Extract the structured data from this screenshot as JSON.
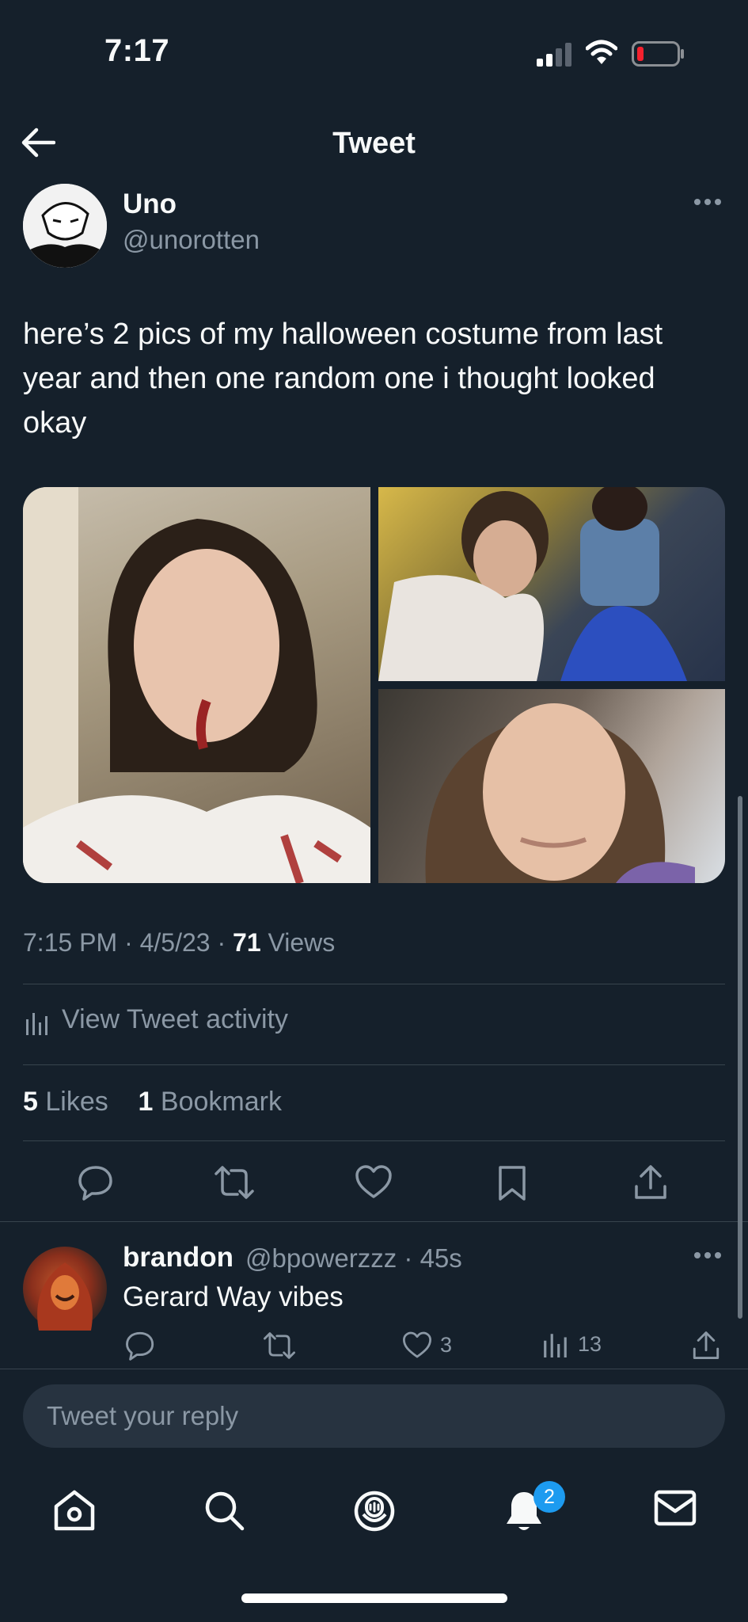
{
  "status_bar": {
    "time": "7:17",
    "signal_icon": "signal-icon",
    "wifi_icon": "wifi-icon",
    "battery_icon": "battery-low-icon",
    "battery_color": "#f4212e"
  },
  "header": {
    "title": "Tweet",
    "back_icon": "arrow-left-icon"
  },
  "tweet": {
    "author_name": "Uno",
    "author_handle": "@unorotten",
    "text": "here’s 2 pics of my halloween costume from last year and then one random one i thought looked okay",
    "photos": 3,
    "time": "7:15 PM",
    "date": "4/5/23",
    "views_count": "71",
    "views_label": "Views",
    "activity_label": "View Tweet activity",
    "likes_count": "5",
    "likes_label": "Likes",
    "bookmarks_count": "1",
    "bookmarks_label": "Bookmark",
    "action_icons": [
      "reply-icon",
      "retweet-icon",
      "like-icon",
      "bookmark-icon",
      "share-icon"
    ]
  },
  "reply": {
    "author_name": "brandon",
    "author_handle": "@bpowerzzz",
    "time": "45s",
    "text": "Gerard Way vibes",
    "likes": "3",
    "views": "13"
  },
  "reply_input": {
    "placeholder": "Tweet your reply"
  },
  "tab_bar": {
    "items": [
      "home-icon",
      "search-icon",
      "spaces-icon",
      "notifications-icon",
      "messages-icon"
    ],
    "notification_count": "2"
  },
  "colors": {
    "background": "#15202b",
    "muted": "#8b98a5",
    "accent": "#1d9bf0",
    "divider": "#38444d"
  }
}
